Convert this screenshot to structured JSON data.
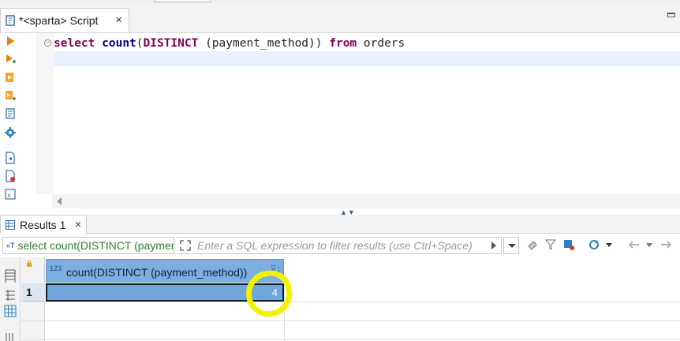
{
  "editor_tab": {
    "title": "*<sparta> Script",
    "close_glyph": "×"
  },
  "editor": {
    "line1": {
      "t1": "select",
      "t2": " ",
      "t3": "count",
      "t4": "(",
      "t5": "DISTINCT",
      "t6": " (payment_method)) ",
      "t7": "from",
      "t8": " orders"
    },
    "fold_glyph": "⊖"
  },
  "splitter_glyph": "▲▼",
  "results_tab": {
    "label": "Results 1",
    "close_glyph": "×"
  },
  "filter": {
    "query_icon": "«T",
    "query_text": "select count(DISTINCT (payment_method)) from orders",
    "placeholder": "Enter a SQL expression to filter results (use Ctrl+Space)"
  },
  "grid": {
    "column": {
      "type_badge": "123",
      "name": "count(DISTINCT (payment_method))",
      "sort_glyph": "⊽↕"
    },
    "rows": [
      {
        "num": "1",
        "value": "4"
      }
    ]
  },
  "colors": {
    "keyword": "#7f0055",
    "selection": "#6ea6dd",
    "header": "#7cafe0",
    "annotation": "#f2f200"
  }
}
